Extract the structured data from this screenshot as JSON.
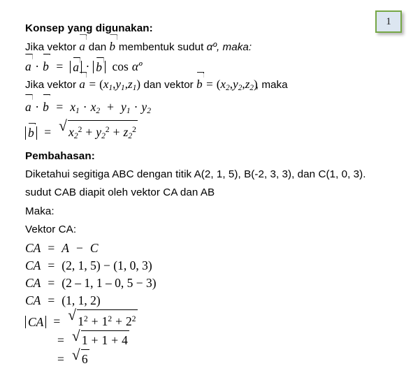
{
  "badge": {
    "number": "1",
    "fill_color": "#dce6f1",
    "border_color": "#76a746"
  },
  "document": {
    "section_concept_heading": "Konsep yang digunakan:",
    "concept_intro_pre": "Jika vektor",
    "concept_intro_mid": "dan",
    "concept_intro_post": "membentuk sudut",
    "concept_intro_alpha": "αº, maka:",
    "formula_dot_product_label": "a⃗ · b⃗ = |a⃗| · |b⃗| cos αº",
    "coords_intro_pre": "Jika vektor",
    "coords_intro_eq1": "= (x₁, y₁, z₁)",
    "coords_intro_mid": "dan vektor",
    "coords_intro_eq2": "= (x₂, y₂, z₂), maka",
    "formula_components": "a⃗ · b⃗ = x₁ · x₂ + y₁ · y₂",
    "formula_magnitude": "|b⃗| = √(x₂² + y₂² + z₂²)",
    "section_solution_heading": "Pembahasan:",
    "given_line": "Diketahui segitiga ABC dengan titik A(2, 1, 5), B(-2, 3, 3), dan C(1, 0, 3).",
    "angle_line": "sudut CAB diapit oleh vektor CA dan AB",
    "maka_label": "Maka:",
    "vektor_ca_label": "Vektor CA:",
    "ca_step1_lhs": "CA",
    "ca_step1_rhs_a": "A",
    "ca_step1_rhs_b": "C",
    "ca_step2_rhs": "(2, 1, 5)  −  (1, 0, 3)",
    "ca_step3_rhs": "(2 – 1, 1 – 0, 5 − 3)",
    "ca_step4_rhs": "(1, 1, 2)",
    "magnitude_lhs": "|CA|",
    "magnitude_step1": "√(1² + 1² + 2²)",
    "magnitude_step2": "√(1 + 1 + 4)",
    "magnitude_step3": "√6",
    "symbols": {
      "equals": "=",
      "minus": "−",
      "plus": "+",
      "dot": "·",
      "radical": "√",
      "vec_a": "a",
      "vec_b": "b",
      "alpha_deg": "αº",
      "cos": "cos",
      "x": "x",
      "y": "y",
      "z": "z",
      "one": "1",
      "two": "2",
      "four": "4",
      "six": "6",
      "sub1": "1",
      "sub2": "2",
      "sup2": "2",
      "paren_open": "(",
      "paren_close": ")",
      "comma": ",",
      "CA": "CA",
      "A": "A",
      "C": "C"
    }
  }
}
